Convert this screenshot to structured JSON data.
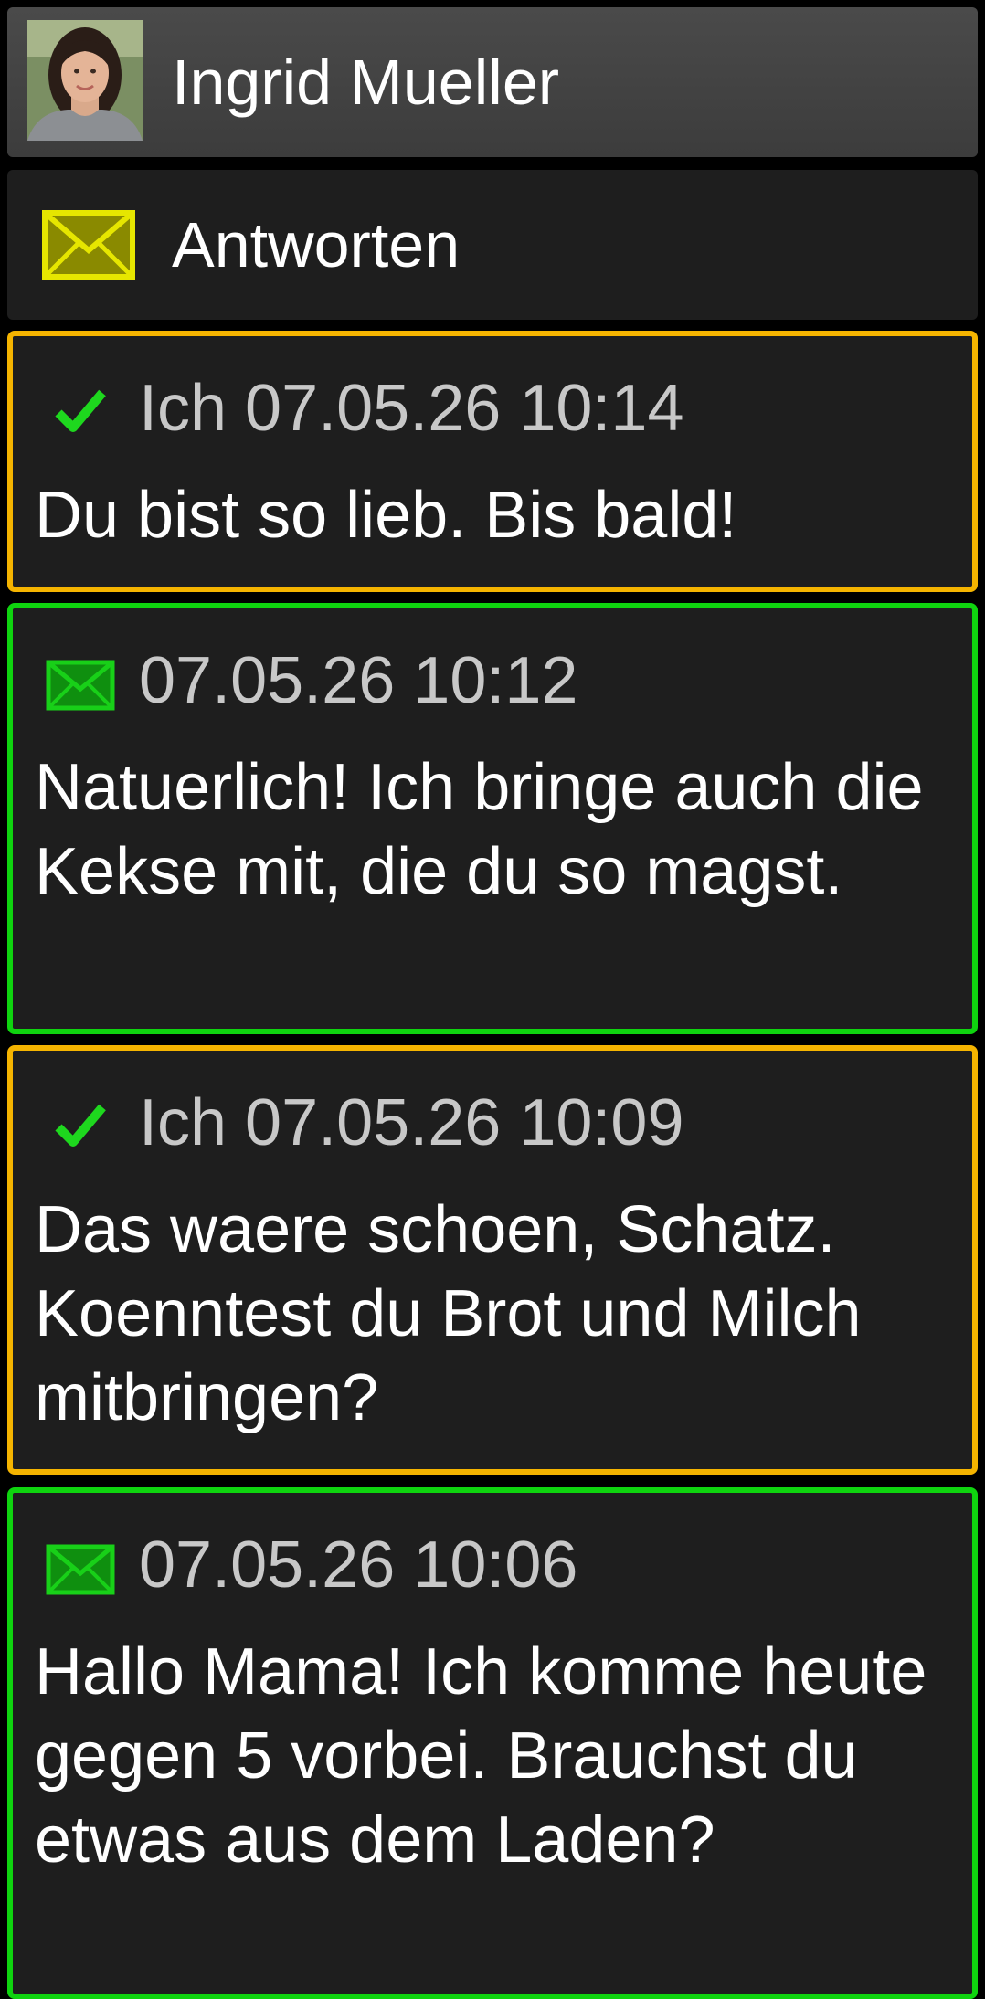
{
  "contact": {
    "name": "Ingrid Mueller",
    "avatar_icon": "contact-photo"
  },
  "reply": {
    "label": "Antworten",
    "icon": "envelope-icon",
    "icon_color": "#e6e600"
  },
  "colors": {
    "sent_border": "#f5b400",
    "received_border": "#0fd40f",
    "check": "#1ed81e",
    "received_envelope": "#18d018"
  },
  "messages": [
    {
      "direction": "sent",
      "status_icon": "check-icon",
      "meta": "Ich 07.05.26 10:14",
      "text": "Du bist so lieb. Bis bald!"
    },
    {
      "direction": "received",
      "status_icon": "envelope-icon",
      "meta": "07.05.26 10:12",
      "text": "Natuerlich! Ich bringe auch die Kekse mit, die du so magst."
    },
    {
      "direction": "sent",
      "status_icon": "check-icon",
      "meta": "Ich 07.05.26 10:09",
      "text": "Das waere schoen, Schatz. Koenntest du Brot und Milch mitbringen?"
    },
    {
      "direction": "received",
      "status_icon": "envelope-icon",
      "meta": "07.05.26 10:06",
      "text": "Hallo Mama! Ich komme heute gegen 5 vorbei. Brauchst du etwas aus dem Laden?"
    }
  ]
}
